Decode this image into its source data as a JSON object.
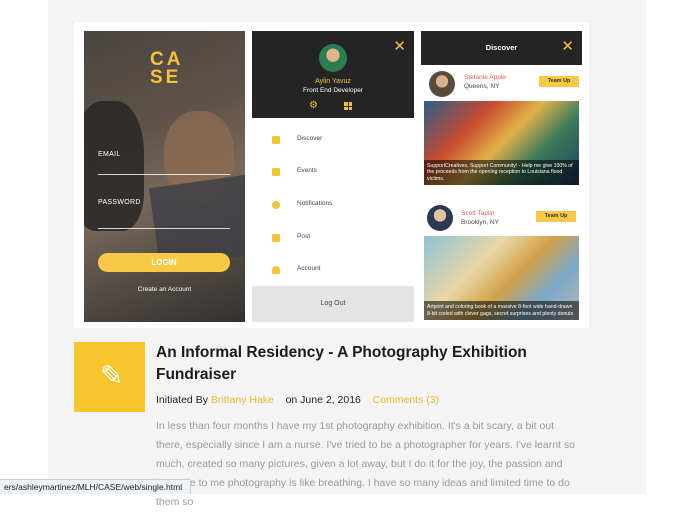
{
  "login_screen": {
    "logo": "CASE",
    "logo_line1": "CA",
    "logo_line2": "SE",
    "email_label": "EMAIL",
    "password_label": "PASSWORD",
    "login_button": "LOGIN",
    "create_account": "Create an Account"
  },
  "menu_screen": {
    "user_name": "Aylin Yavuz",
    "user_role": "Front End Developer",
    "items": [
      {
        "label": "Discover",
        "icon": "discover-icon"
      },
      {
        "label": "Events",
        "icon": "calendar-icon"
      },
      {
        "label": "Notifications",
        "icon": "bell-icon"
      },
      {
        "label": "Post",
        "icon": "camera-icon"
      },
      {
        "label": "Account",
        "icon": "user-icon"
      }
    ],
    "logout": "Log Out"
  },
  "discover_screen": {
    "title": "Discover",
    "cards": [
      {
        "name": "Stefanie Apple",
        "location": "Queens, NY",
        "button": "Team Up",
        "caption": "SupportCreatives, Support Community! - Help me give 100% of the proceeds from the opening reception to Louisiana flood victims."
      },
      {
        "name": "Scott Taplin",
        "location": "Brooklyn, NY",
        "button": "Team Up",
        "caption": "Artprint and coloring book of a massive 8-foot wide hand-drawn 8-bit coded with clever gags, secret surprises and plenty donuts"
      }
    ]
  },
  "post": {
    "title": "An Informal Residency - A Photography Exhibition Fundraiser",
    "initiated_by_label": "Initiated By",
    "author": "Brittany Hake",
    "date": "on June 2, 2016",
    "comments": "Comments (3)",
    "body": "In less than four months I have my 1st photography exhibition. It's a bit scary, a bit out there, especially since I am a nurse. I've tried to be a photographer for years. I've learnt so much, created so many pictures, given a lot away, but I do it for the joy, the passion and because to me photography is like breathing. I have so many ideas and limited time to do them so"
  },
  "status_bar": {
    "url": "ers/ashleymartinez/MLH/CASE/web/single.html"
  },
  "colors": {
    "accent": "#f7c52c",
    "dark": "#242424",
    "name_red": "#e85b50",
    "body_gray": "#9a9a9a"
  }
}
